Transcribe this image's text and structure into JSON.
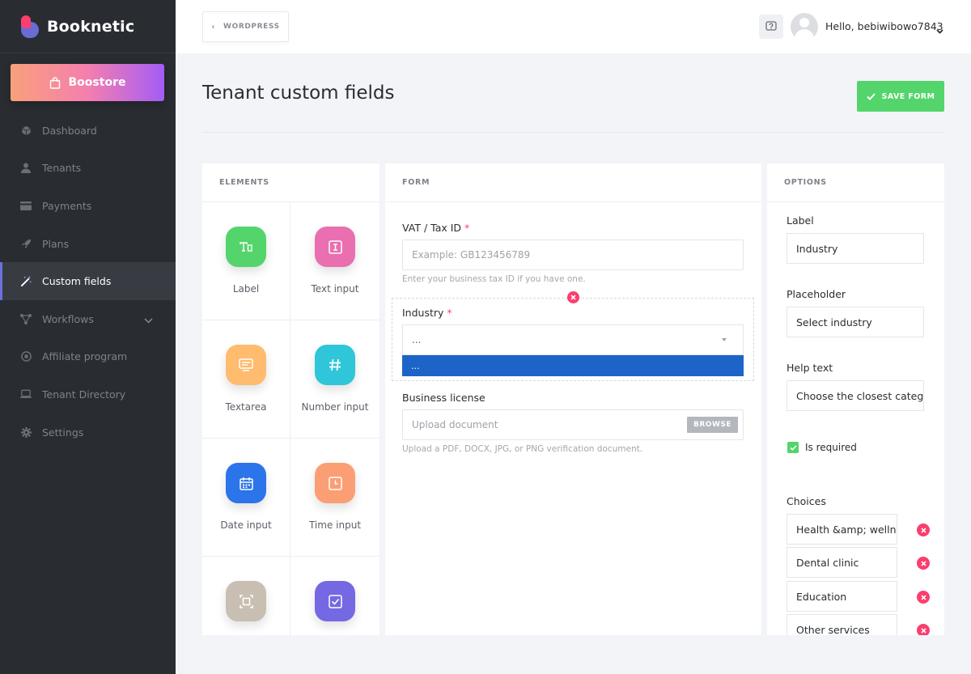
{
  "brand": {
    "name": "Booknetic"
  },
  "sidebar": {
    "boostore_label": "Boostore",
    "items": [
      {
        "label": "Dashboard",
        "icon": "cube-icon"
      },
      {
        "label": "Tenants",
        "icon": "user-icon"
      },
      {
        "label": "Payments",
        "icon": "credit-card-icon"
      },
      {
        "label": "Plans",
        "icon": "rocket-icon"
      },
      {
        "label": "Custom fields",
        "icon": "magic-wand-icon",
        "active": true
      },
      {
        "label": "Workflows",
        "icon": "nodes-icon",
        "has_submenu": true
      },
      {
        "label": "Affiliate program",
        "icon": "target-icon"
      },
      {
        "label": "Tenant Directory",
        "icon": "laptop-icon"
      },
      {
        "label": "Settings",
        "icon": "gear-icon"
      }
    ]
  },
  "header": {
    "back_label": "WORDPRESS",
    "greeting": "Hello, bebiwibowo7843"
  },
  "page": {
    "title": "Tenant custom fields",
    "save_label": "SAVE FORM"
  },
  "elements_panel": {
    "heading": "ELEMENTS",
    "items": [
      {
        "label": "Label",
        "color": "#53d56c"
      },
      {
        "label": "Text input",
        "color": "#e96fb0"
      },
      {
        "label": "Textarea",
        "color": "#ffbb6e"
      },
      {
        "label": "Number input",
        "color": "#2ec6d8"
      },
      {
        "label": "Date input",
        "color": "#2c74ea"
      },
      {
        "label": "Time input",
        "color": "#fb9e74"
      },
      {
        "label": "",
        "color": "#c8beb2"
      },
      {
        "label": "",
        "color": "#7468e3"
      }
    ]
  },
  "form_panel": {
    "heading": "FORM",
    "vat": {
      "label": "VAT / Tax ID",
      "required_mark": "*",
      "placeholder": "Example: GB123456789",
      "help": "Enter your business tax ID if you have one."
    },
    "industry": {
      "label": "Industry",
      "required_mark": "*",
      "selected": "...",
      "option": "..."
    },
    "license": {
      "label": "Business license",
      "placeholder": "Upload document",
      "browse_label": "BROWSE",
      "help": "Upload a PDF, DOCX, JPG, or PNG verification document."
    }
  },
  "options_panel": {
    "heading": "OPTIONS",
    "label_title": "Label",
    "label_value": "Industry",
    "placeholder_title": "Placeholder",
    "placeholder_value": "Select industry",
    "help_title": "Help text",
    "help_value": "Choose the closest category",
    "required_label": "Is required",
    "required_checked": true,
    "choices_title": "Choices",
    "choices": [
      "Health &amp; wellness",
      "Dental clinic",
      "Education",
      "Other services"
    ]
  },
  "colors": {
    "sidebar_bg": "#292d32",
    "accent": "#6c70dc",
    "success": "#53d56c",
    "danger": "#fb3e6e",
    "select_highlight": "#1e64c8"
  }
}
